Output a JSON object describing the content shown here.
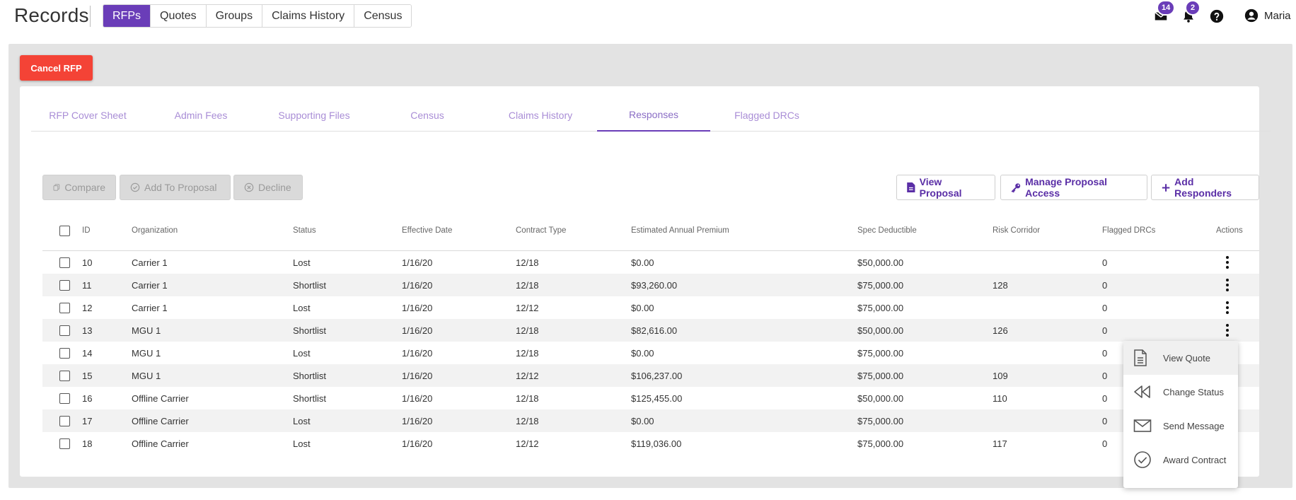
{
  "app": {
    "title": "Records"
  },
  "nav": {
    "tabs": [
      "RFPs",
      "Quotes",
      "Groups",
      "Claims History",
      "Census"
    ],
    "active": "RFPs"
  },
  "notifications": {
    "messages_count": "14",
    "alerts_count": "2"
  },
  "user": {
    "name": "Maria"
  },
  "actions": {
    "cancel_label": "Cancel RFP"
  },
  "subtabs": {
    "items": [
      "RFP Cover Sheet",
      "Admin Fees",
      "Supporting Files",
      "Census",
      "Claims History",
      "Responses",
      "Flagged DRCs"
    ],
    "active": "Responses"
  },
  "toolbar": {
    "compare": "Compare",
    "add_to_proposal": "Add To Proposal",
    "decline": "Decline",
    "view_proposal": "View Proposal",
    "manage_access": "Manage Proposal Access",
    "add_responders": "Add Responders"
  },
  "table": {
    "columns": [
      "ID",
      "Organization",
      "Status",
      "Effective Date",
      "Contract Type",
      "Estimated Annual Premium",
      "Spec Deductible",
      "Risk Corridor",
      "Flagged DRCs",
      "Actions"
    ],
    "rows": [
      {
        "id": "10",
        "org": "Carrier 1",
        "status": "Lost",
        "date": "1/16/20",
        "contract": "12/18",
        "premium": "$0.00",
        "deductible": "$50,000.00",
        "corridor": "",
        "flagged": "0"
      },
      {
        "id": "11",
        "org": "Carrier 1",
        "status": "Shortlist",
        "date": "1/16/20",
        "contract": "12/18",
        "premium": "$93,260.00",
        "deductible": "$75,000.00",
        "corridor": "128",
        "flagged": "0"
      },
      {
        "id": "12",
        "org": "Carrier 1",
        "status": "Lost",
        "date": "1/16/20",
        "contract": "12/12",
        "premium": "$0.00",
        "deductible": "$75,000.00",
        "corridor": "",
        "flagged": "0"
      },
      {
        "id": "13",
        "org": "MGU 1",
        "status": "Shortlist",
        "date": "1/16/20",
        "contract": "12/18",
        "premium": "$82,616.00",
        "deductible": "$50,000.00",
        "corridor": "126",
        "flagged": "0"
      },
      {
        "id": "14",
        "org": "MGU 1",
        "status": "Lost",
        "date": "1/16/20",
        "contract": "12/18",
        "premium": "$0.00",
        "deductible": "$75,000.00",
        "corridor": "",
        "flagged": "0"
      },
      {
        "id": "15",
        "org": "MGU 1",
        "status": "Shortlist",
        "date": "1/16/20",
        "contract": "12/12",
        "premium": "$106,237.00",
        "deductible": "$75,000.00",
        "corridor": "109",
        "flagged": "0"
      },
      {
        "id": "16",
        "org": "Offline Carrier",
        "status": "Shortlist",
        "date": "1/16/20",
        "contract": "12/18",
        "premium": "$125,455.00",
        "deductible": "$50,000.00",
        "corridor": "110",
        "flagged": "0"
      },
      {
        "id": "17",
        "org": "Offline Carrier",
        "status": "Lost",
        "date": "1/16/20",
        "contract": "12/18",
        "premium": "$0.00",
        "deductible": "$75,000.00",
        "corridor": "",
        "flagged": "0"
      },
      {
        "id": "18",
        "org": "Offline Carrier",
        "status": "Lost",
        "date": "1/16/20",
        "contract": "12/12",
        "premium": "$119,036.00",
        "deductible": "$75,000.00",
        "corridor": "117",
        "flagged": "0"
      }
    ]
  },
  "context_menu": {
    "items": [
      "View Quote",
      "Change Status",
      "Send Message",
      "Award Contract"
    ]
  },
  "colors": {
    "primary": "#6a3db8",
    "danger": "#f44336"
  }
}
